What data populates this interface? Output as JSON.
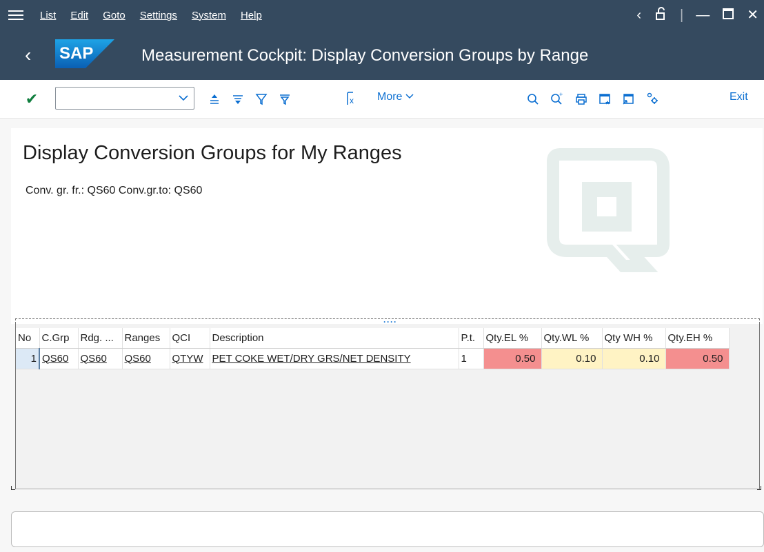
{
  "menu": {
    "items": [
      {
        "label": "List"
      },
      {
        "label": "Edit"
      },
      {
        "label": "Goto"
      },
      {
        "label": "Settings"
      },
      {
        "label": "System"
      },
      {
        "label": "Help"
      }
    ]
  },
  "titlebar": {
    "logo_text": "SAP",
    "title": "Measurement Cockpit: Display Conversion Groups by Range"
  },
  "toolbar": {
    "command_value": "",
    "more_label": "More",
    "exit_label": "Exit",
    "icons": [
      "check-icon",
      "sort-ascending-icon",
      "sort-descending-icon",
      "filter-icon",
      "filter-settings-icon",
      "formula-icon",
      "search-icon",
      "search-next-icon",
      "print-icon",
      "window-favorite-icon",
      "window-new-icon",
      "settings-icon"
    ]
  },
  "header": {
    "heading": "Display Conversion Groups for My Ranges",
    "subheading": "Conv. gr. fr.: QS60 Conv.gr.to: QS60"
  },
  "grid": {
    "columns": [
      "No",
      "C.Grp",
      "Rdg. ...",
      "Ranges",
      "QCI",
      "Description",
      "P.t.",
      "Qty.EL %",
      "Qty.WL %",
      "Qty WH %",
      "Qty.EH %"
    ],
    "rows": [
      {
        "no": "1",
        "cgrp": "QS60",
        "rdg": "QS60",
        "ranges": "QS60",
        "qci": "QTYW",
        "description": "PET COKE WET/DRY GRS/NET DENSITY",
        "pt": "1",
        "qty_el": "0.50",
        "qty_wl": "0.10",
        "qty_wh": "0.10",
        "qty_eh": "0.50"
      }
    ]
  },
  "colors": {
    "shell": "#354a5f",
    "limit_error": "#f48f8f",
    "limit_warning": "#fff3c4",
    "accent": "#0a6ed1"
  }
}
